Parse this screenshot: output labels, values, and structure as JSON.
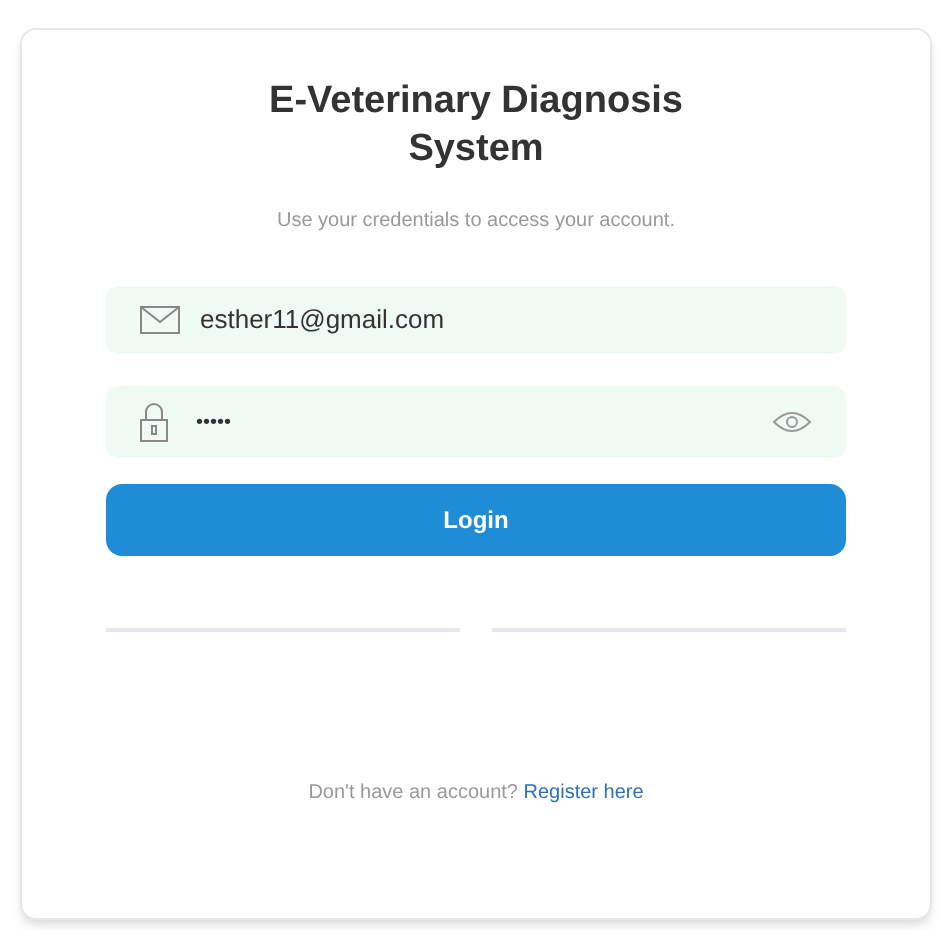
{
  "title": "E-Veterinary Diagnosis System",
  "subtitle": "Use your credentials to access your account.",
  "email": {
    "value": "esther11@gmail.com"
  },
  "password": {
    "value": "•••••"
  },
  "login_button": "Login",
  "footer": {
    "text": "Don't have an account?",
    "link": "Register here"
  }
}
